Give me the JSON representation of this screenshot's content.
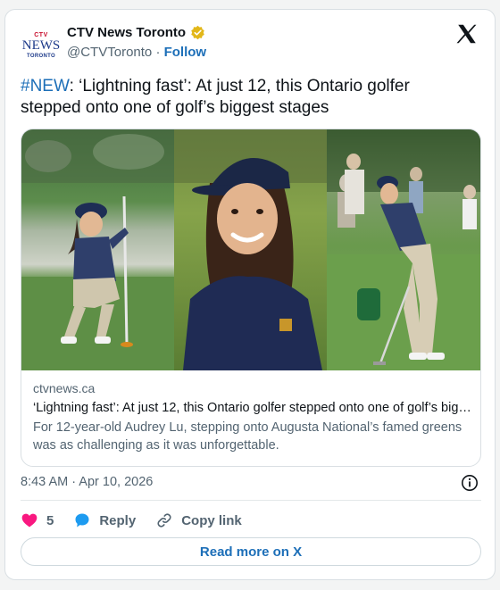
{
  "account": {
    "logo_top": "CTV",
    "logo_main": "NEWS",
    "logo_bottom": "TORONTO",
    "display_name": "CTV News Toronto",
    "handle": "@CTVToronto",
    "separator": "·",
    "follow_label": "Follow"
  },
  "tweet": {
    "hashtag": "#NEW",
    "text": ": ‘Lightning fast’: At just 12, this Ontario golfer stepped onto one of golf’s biggest stages"
  },
  "link_card": {
    "image_alt": "Collage of a young golfer on the course and in an interview",
    "domain": "ctvnews.ca",
    "title": "‘Lightning fast’: At just 12, this Ontario golfer stepped onto one of golf’s biggest stages",
    "description": "For 12-year-old Audrey Lu, stepping onto Augusta National’s famed greens was as challenging as it was unforgettable."
  },
  "meta": {
    "timestamp": "8:43 AM · Apr 10, 2026"
  },
  "actions": {
    "like_count": "5",
    "reply_label": "Reply",
    "copy_link_label": "Copy link"
  },
  "footer": {
    "read_more_label": "Read more on X"
  },
  "colors": {
    "accent": "#1d6fb8",
    "like": "#f91880",
    "reply_bubble": "#1d9bf0",
    "verified_gold": "#e2b719",
    "text_secondary": "#536471"
  },
  "icons": [
    "verified-badge-icon",
    "x-logo-icon",
    "info-icon",
    "heart-icon",
    "reply-bubble-icon",
    "link-icon"
  ]
}
